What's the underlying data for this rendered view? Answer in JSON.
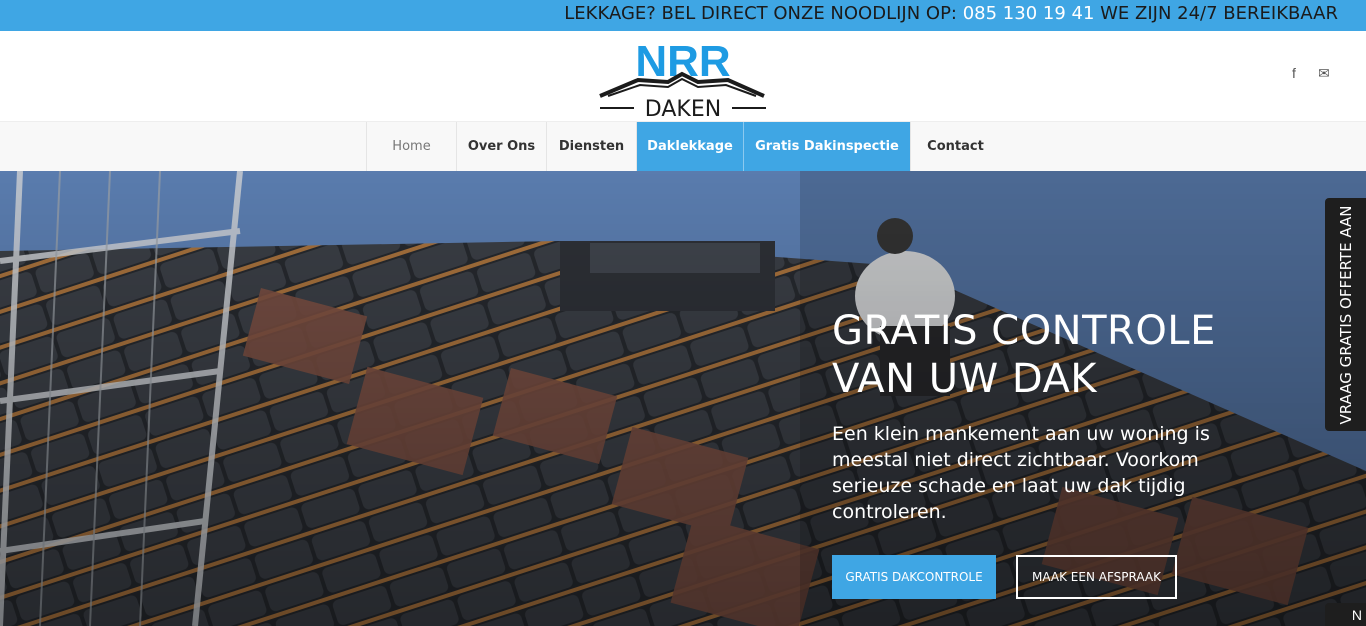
{
  "topbar": {
    "notice": "LEKKAGE? BEL DIRECT ONZE NOODLIJN OP: ",
    "phone": "085 130 19 41",
    "suffix": " WE ZIJN 24/7 BEREIKBAAR"
  },
  "logo": {
    "top_text": "NRR",
    "bottom_text": "DAKEN",
    "colors": {
      "blue": "#1e9be3",
      "dark": "#1b1b1b"
    }
  },
  "social": {
    "facebook_icon": "f",
    "mail_icon": "✉"
  },
  "nav": {
    "items": [
      {
        "label": "Home"
      },
      {
        "label": "Over Ons"
      },
      {
        "label": "Diensten"
      },
      {
        "label": "Daklekkage"
      },
      {
        "label": "Gratis Dakinspectie"
      },
      {
        "label": "Contact"
      }
    ]
  },
  "hero": {
    "title_line1": "GRATIS CONTROLE",
    "title_line2": "VAN UW DAK",
    "subtitle": "Een klein mankement aan uw woning is meestal niet direct zichtbaar. Voorkom serieuze schade en laat uw dak tijdig controleren.",
    "primary_button": "GRATIS DAKCONTROLE",
    "secondary_button": "MAAK EEN AFSPRAAK"
  },
  "side_tab": {
    "label": "VRAAG GRATIS OFFERTE AAN",
    "label2": "N"
  },
  "colors": {
    "accent": "#3fa6e4",
    "dark_tab": "#1e1e1e"
  }
}
